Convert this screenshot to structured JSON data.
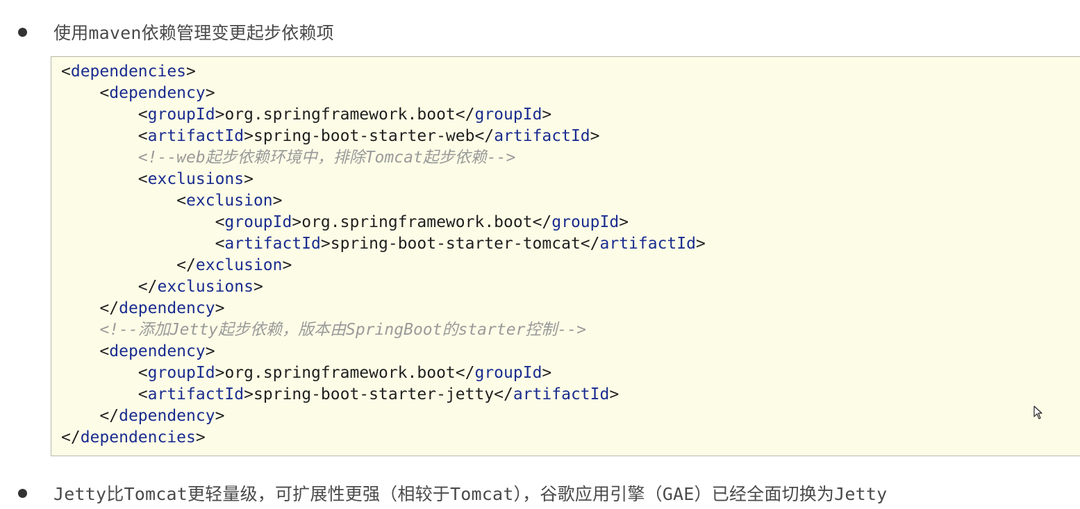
{
  "bullets": {
    "first": "使用maven依赖管理变更起步依赖项",
    "second": "Jetty比Tomcat更轻量级，可扩展性更强（相较于Tomcat），谷歌应用引擎（GAE）已经全面切换为Jetty"
  },
  "code": {
    "l1_tag": "dependencies",
    "l2_tag": "dependency",
    "l3_tag": "groupId",
    "l3_text": "org.springframework.boot",
    "l4_tag": "artifactId",
    "l4_text": "spring-boot-starter-web",
    "l5_comment": "<!--web起步依赖环境中，排除Tomcat起步依赖-->",
    "l6_tag": "exclusions",
    "l7_tag": "exclusion",
    "l8_tag": "groupId",
    "l8_text": "org.springframework.boot",
    "l9_tag": "artifactId",
    "l9_text": "spring-boot-starter-tomcat",
    "l10_tag": "exclusion",
    "l11_tag": "exclusions",
    "l12_tag": "dependency",
    "l13_comment": "<!--添加Jetty起步依赖，版本由SpringBoot的starter控制-->",
    "l14_tag": "dependency",
    "l15_tag": "groupId",
    "l15_text": "org.springframework.boot",
    "l16_tag": "artifactId",
    "l16_text": "spring-boot-starter-jetty",
    "l17_tag": "dependency",
    "l18_tag": "dependencies"
  },
  "icons": {
    "bullet": "bullet-dot-icon",
    "cursor": "mouse-pointer-icon"
  },
  "colors": {
    "tag": "#1a2c8f",
    "comment": "#9a9a9a",
    "code_background": "#fdfde7"
  }
}
